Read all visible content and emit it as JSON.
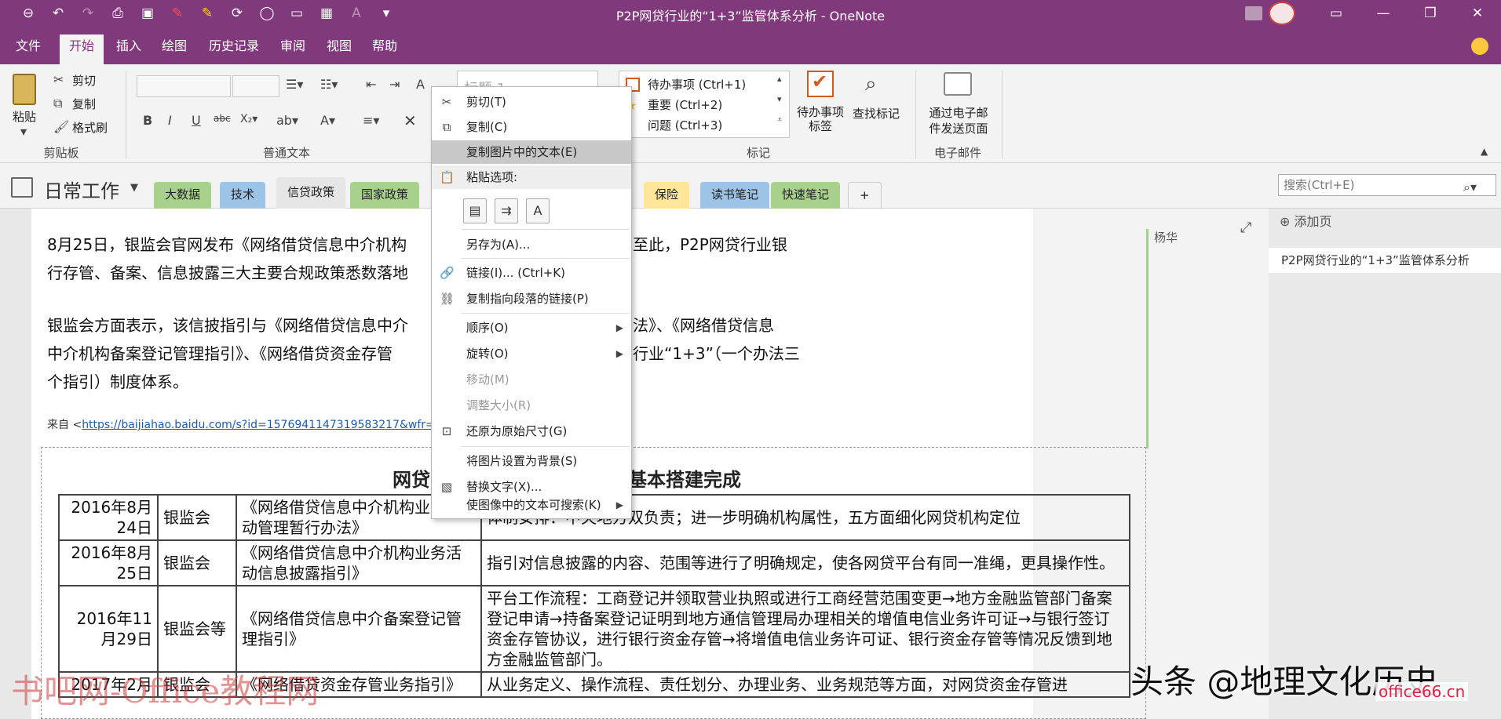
{
  "window": {
    "title": "P2P网贷行业的“1+3”监管体系分析  -  OneNote",
    "quick_access_icons": [
      "back-icon",
      "undo-icon",
      "redo-icon",
      "print-icon",
      "print-preview-icon",
      "pen-red-icon",
      "highlighter-yellow-icon",
      "sync-icon",
      "lasso-icon",
      "save-icon",
      "send-icon",
      "format-icon",
      "customize-icon"
    ],
    "controls": [
      "restore-ribbon-icon",
      "minimize-icon",
      "maximize-icon",
      "close-icon"
    ]
  },
  "menu_tabs": [
    "文件",
    "开始",
    "插入",
    "绘图",
    "历史记录",
    "审阅",
    "视图",
    "帮助"
  ],
  "active_tab": "开始",
  "ribbon": {
    "clipboard": {
      "paste": "粘贴",
      "cut": "剪切",
      "copy": "复制",
      "format_painter": "格式刷",
      "label": "剪贴板"
    },
    "basic_text": {
      "label": "普通文本"
    },
    "styles": {
      "current": "标题 1"
    },
    "tags": {
      "items": [
        "待办事项 (Ctrl+1)",
        "重要 (Ctrl+2)",
        "问题 (Ctrl+3)"
      ],
      "todo_tag": "待办事项\n标签",
      "find_tags": "查找标记",
      "label": "标记"
    },
    "email": {
      "send": "通过电子邮\n件发送页面",
      "label": "电子邮件"
    }
  },
  "notebook": {
    "name": "日常工作",
    "sections": [
      {
        "name": "大数据",
        "color": "#a9d18e"
      },
      {
        "name": "技术",
        "color": "#9dc3e6"
      },
      {
        "name": "信贷政策",
        "color": "#e6e6e6"
      },
      {
        "name": "国家政策",
        "color": "#a9d18e"
      },
      {
        "name": "保险",
        "color": "#ffe699"
      },
      {
        "name": "读书笔记",
        "color": "#9dc3e6"
      },
      {
        "name": "快速笔记",
        "color": "#a9d18e"
      }
    ],
    "add_section": "+",
    "search_placeholder": "搜索(Ctrl+E)"
  },
  "page": {
    "author": "杨华",
    "paragraphs": [
      "8月25日，银监会官网发布《网络借贷信息中介机构",
      "行存管、备案、信息披露三大主要合规政策悉数落地",
      "银监会方面表示，该信披指引与《网络借贷信息中介",
      "中介机构备案登记管理指引》、《网络借贷资金存管",
      "个指引）制度体系。"
    ],
    "paragraph_tail": [
      "至此，P2P网贷行业银",
      "法》、《网络借贷信息",
      "行业“1+3”（一个办法三"
    ],
    "source_prefix": "来自 <",
    "source_url": "https://baijiahao.baidu.com/s?id=1576941147319583217&wfr=spi",
    "image_title_left": "网贷",
    "image_title_right": "基本搭建完成",
    "table": [
      {
        "date": "2016年8月24日",
        "org": "银监会",
        "doc": "《网络借贷信息中介机构业务活动管理暂行办法》",
        "desc": "体制安排：中央地方双负责；进一步明确机构属性，五方面细化网贷机构定位"
      },
      {
        "date": "2016年8月25日",
        "org": "银监会",
        "doc": "《网络借贷信息中介机构业务活动信息披露指引》",
        "desc": "指引对信息披露的内容、范围等进行了明确规定，使各网贷平台有同一准绳，更具操作性。"
      },
      {
        "date": "2016年11月29日",
        "org": "银监会等",
        "doc": "《网络借贷信息中介备案登记管理指引》",
        "desc": "平台工作流程：工商登记并领取营业执照或进行工商经营范围变更→地方金融监管部门备案登记申请→持备案登记证明到地方通信管理局办理相关的增值电信业务许可证→与银行签订资金存管协议，进行银行资金存管→将增值电信业务许可证、银行资金存管等情况反馈到地方金融监管部门。"
      },
      {
        "date": "2017年2月",
        "org": "银监会",
        "doc": "《网络借贷资金存管业务指引》",
        "desc": "从业务定义、操作流程、责任划分、办理业务、业务规范等方面，对网贷资金存管进"
      }
    ]
  },
  "page_list": {
    "add_page": "添加页",
    "items": [
      "P2P网贷行业的“1+3”监管体系分析"
    ]
  },
  "context_menu": {
    "items": [
      {
        "label": "剪切(T)",
        "icon": "scissors-icon",
        "state": "normal"
      },
      {
        "label": "复制(C)",
        "icon": "copy-icon",
        "state": "normal"
      },
      {
        "label": "复制图片中的文本(E)",
        "icon": "",
        "state": "highlight"
      },
      {
        "label": "粘贴选项:",
        "icon": "paste-icon",
        "state": "header"
      },
      {
        "label": "另存为(A)...",
        "icon": "",
        "state": "normal"
      },
      {
        "label": "链接(I)...  (Ctrl+K)",
        "icon": "link-icon",
        "state": "normal"
      },
      {
        "label": "复制指向段落的链接(P)",
        "icon": "link-paragraph-icon",
        "state": "normal"
      },
      {
        "label": "顺序(O)",
        "icon": "",
        "state": "submenu"
      },
      {
        "label": "旋转(O)",
        "icon": "",
        "state": "submenu"
      },
      {
        "label": "移动(M)",
        "icon": "",
        "state": "disabled"
      },
      {
        "label": "调整大小(R)",
        "icon": "",
        "state": "disabled"
      },
      {
        "label": "还原为原始尺寸(G)",
        "icon": "restore-size-icon",
        "state": "normal"
      },
      {
        "label": "将图片设置为背景(S)",
        "icon": "",
        "state": "normal"
      },
      {
        "label": "替换文字(X)...",
        "icon": "alt-text-icon",
        "state": "normal"
      },
      {
        "label": "使图像中的文本可搜索(K)",
        "icon": "",
        "state": "submenu"
      }
    ],
    "paste_option_glyphs": [
      "▤",
      "⇉",
      "A"
    ]
  },
  "watermarks": {
    "left": "书吧网-Office教程网",
    "right": "头条 @地理文化历史",
    "corner": "office66.cn"
  }
}
